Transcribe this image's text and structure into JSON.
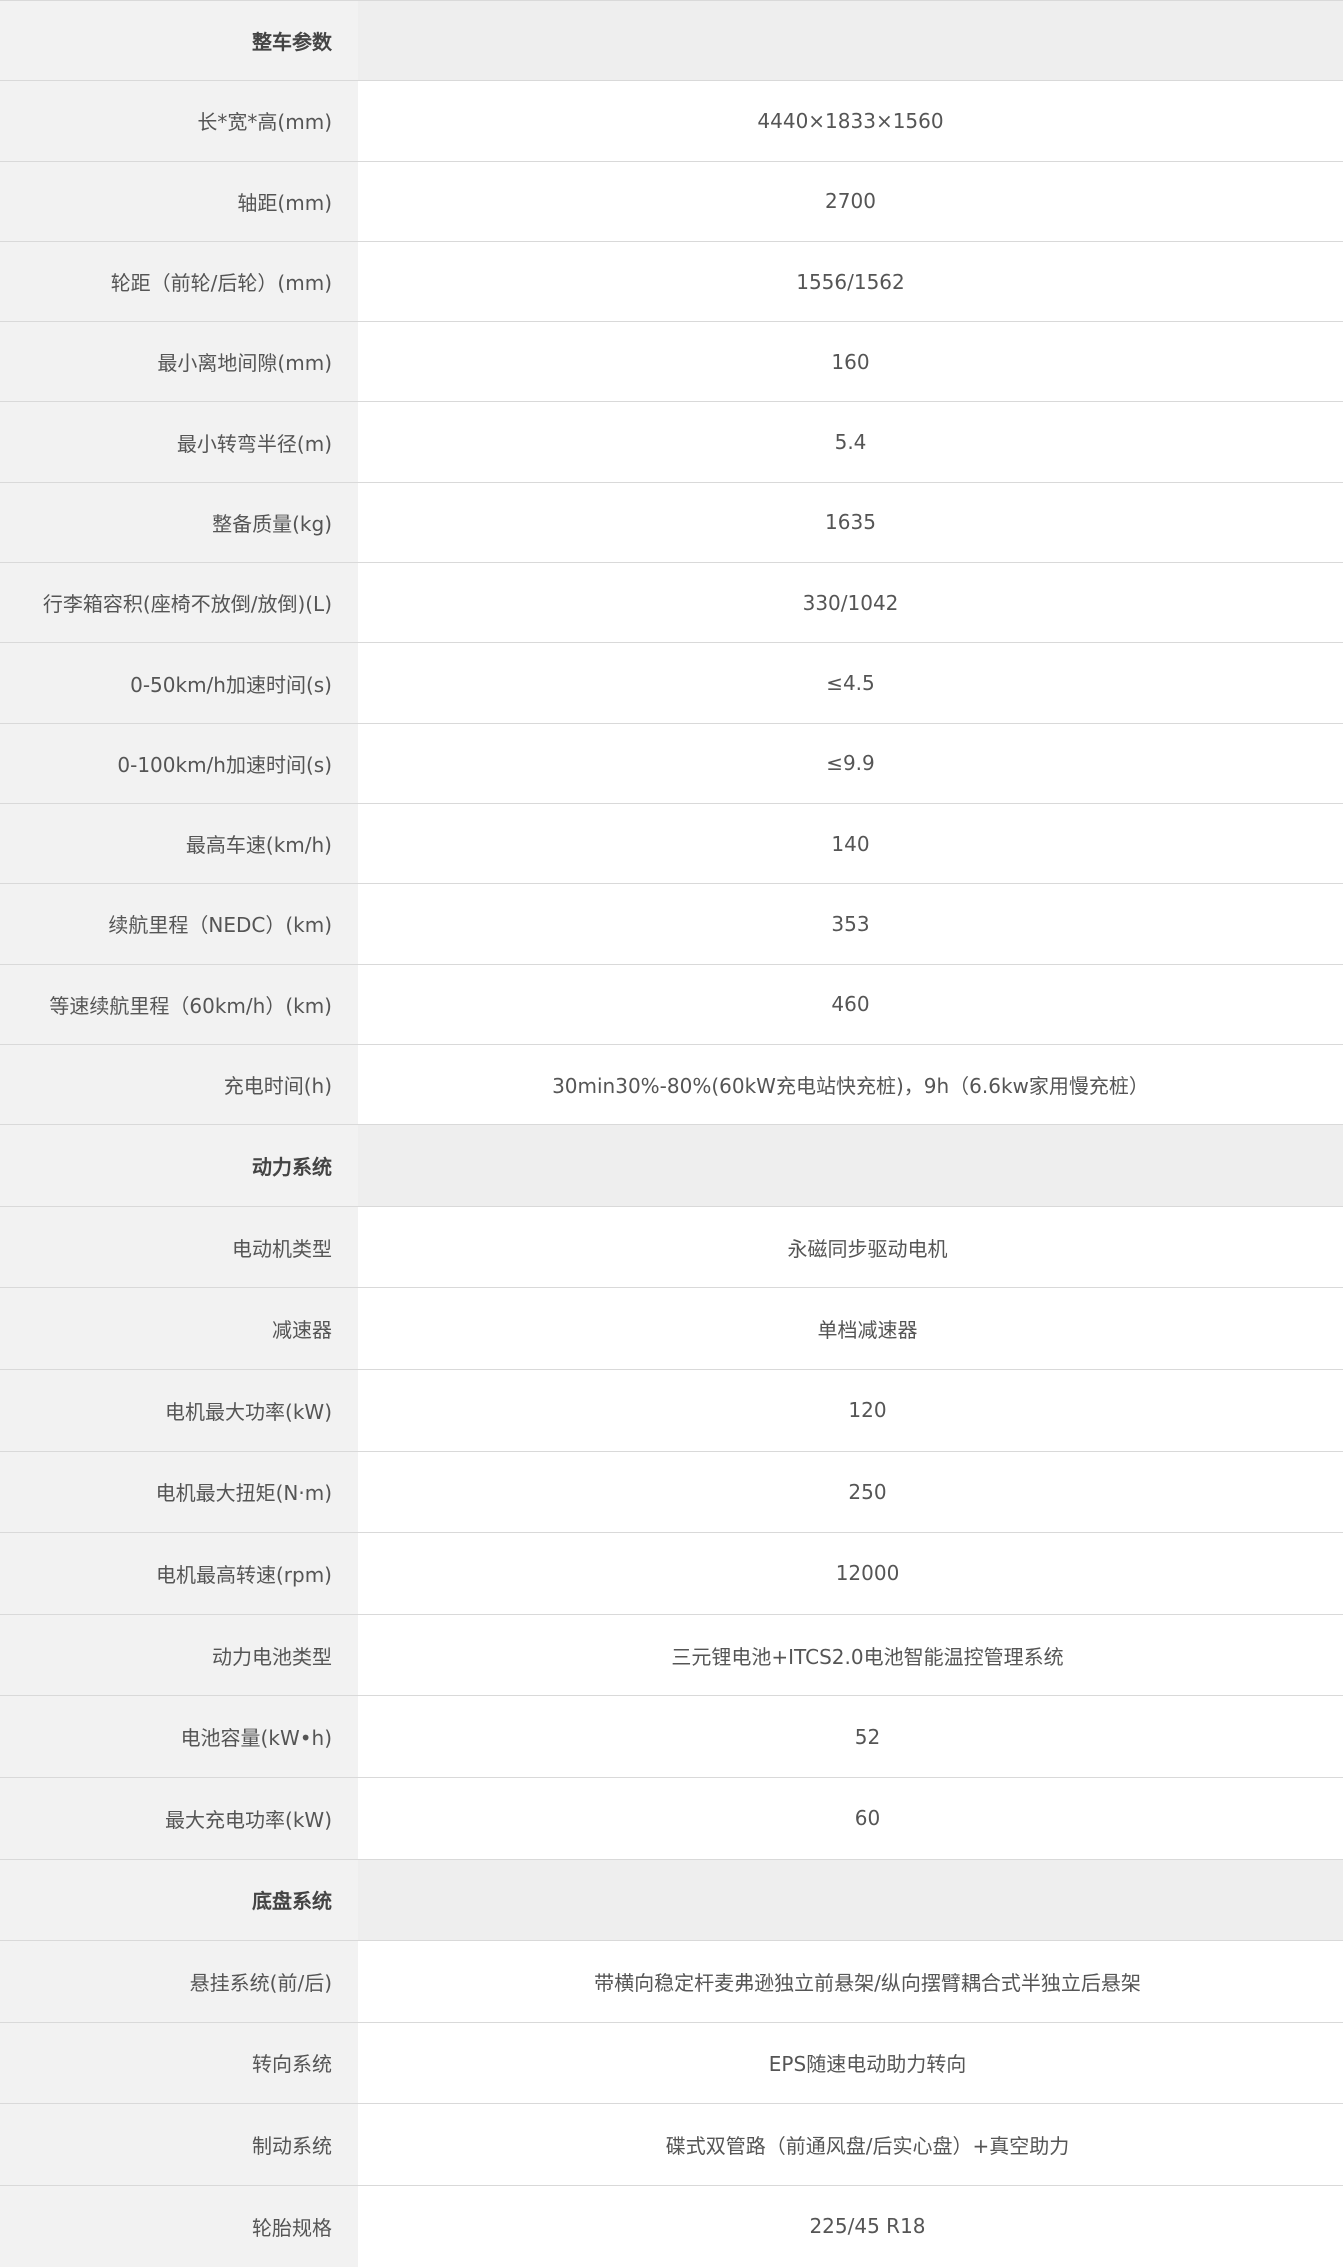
{
  "sections": [
    {
      "title": "整车参数",
      "rows": [
        {
          "label": "长*宽*高(mm)",
          "value": "4440×1833×1560"
        },
        {
          "label": "轴距(mm)",
          "value": "2700"
        },
        {
          "label": "轮距（前轮/后轮）(mm)",
          "value": "1556/1562"
        },
        {
          "label": "最小离地间隙(mm)",
          "value": "160"
        },
        {
          "label": "最小转弯半径(m)",
          "value": "5.4"
        },
        {
          "label": "整备质量(kg)",
          "value": "1635"
        },
        {
          "label": "行李箱容积(座椅不放倒/放倒)(L)",
          "value": "330/1042"
        },
        {
          "label": "0-50km/h加速时间(s)",
          "value": "≤4.5"
        },
        {
          "label": "0-100km/h加速时间(s)",
          "value": "≤9.9"
        },
        {
          "label": "最高车速(km/h)",
          "value": "140"
        },
        {
          "label": "续航里程（NEDC）(km)",
          "value": "353"
        },
        {
          "label": "等速续航里程（60km/h）(km)",
          "value": "460"
        },
        {
          "label": "充电时间(h)",
          "value": "30min30%-80%(60kW充电站快充桩)，9h（6.6kw家用慢充桩）"
        }
      ]
    },
    {
      "title": "动力系统",
      "rows": [
        {
          "label": "电动机类型",
          "value": "永磁同步驱动电机"
        },
        {
          "label": "减速器",
          "value": "单档减速器"
        },
        {
          "label": "电机最大功率(kW)",
          "value": "120"
        },
        {
          "label": "电机最大扭矩(N·m)",
          "value": "250"
        },
        {
          "label": "电机最高转速(rpm)",
          "value": "12000"
        },
        {
          "label": "动力电池类型",
          "value": "三元锂电池+ITCS2.0电池智能温控管理系统"
        },
        {
          "label": "电池容量(kW•h)",
          "value": "52"
        },
        {
          "label": "最大充电功率(kW)",
          "value": "60"
        }
      ]
    },
    {
      "title": "底盘系统",
      "rows": [
        {
          "label": "悬挂系统(前/后)",
          "value": "带横向稳定杆麦弗逊独立前悬架/纵向摆臂耦合式半独立后悬架"
        },
        {
          "label": "转向系统",
          "value": "EPS随速电动助力转向"
        },
        {
          "label": "制动系统",
          "value": "碟式双管路（前通风盘/后实心盘）+真空助力"
        },
        {
          "label": "轮胎规格",
          "value": "225/45 R18"
        }
      ]
    }
  ]
}
